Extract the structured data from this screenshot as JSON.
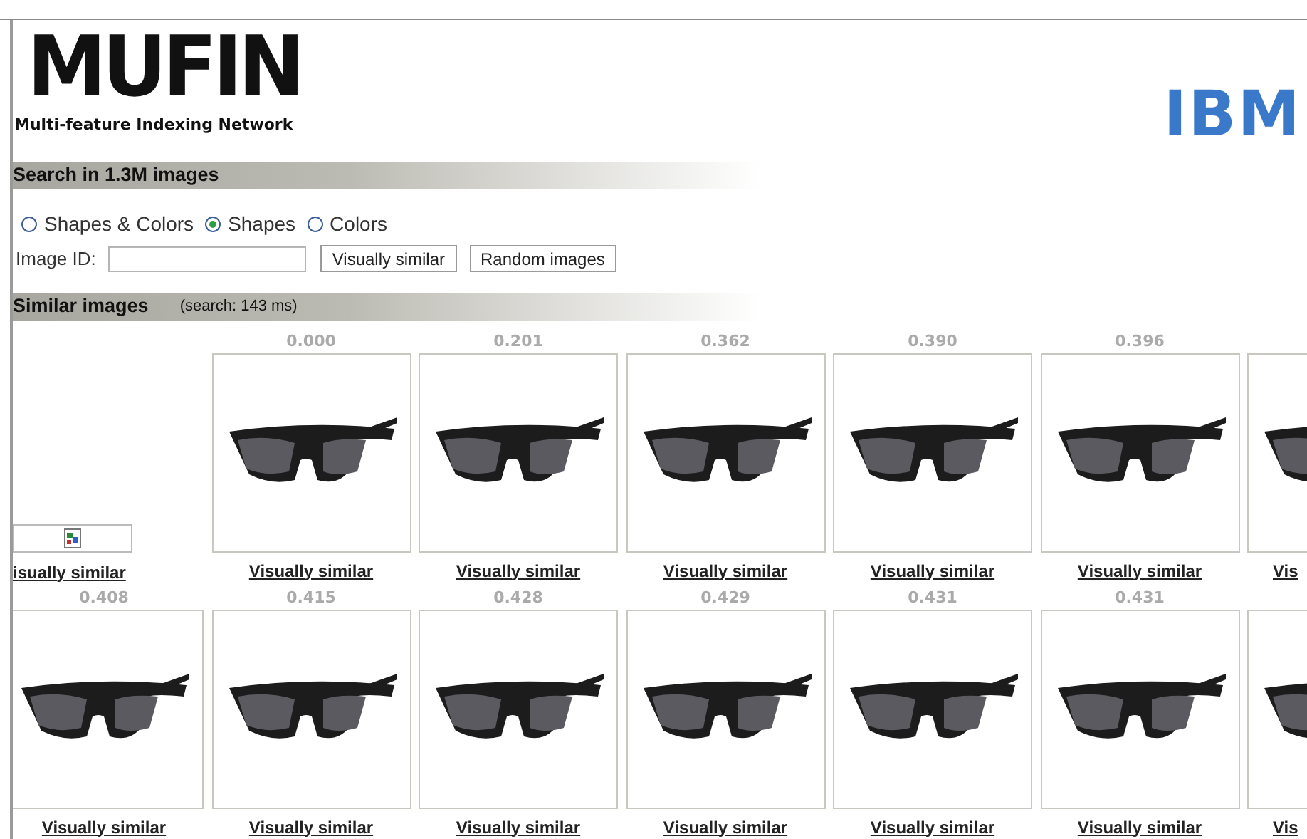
{
  "logo": {
    "title": "MUFIN",
    "subtitle": "Multi-feature Indexing Network"
  },
  "partner_logo": "IBM",
  "search": {
    "heading": "Search in 1.3M images",
    "modes": [
      {
        "label": "Shapes & Colors",
        "selected": false
      },
      {
        "label": "Shapes",
        "selected": true
      },
      {
        "label": "Colors",
        "selected": false
      }
    ],
    "image_id_label": "Image ID:",
    "buttons": [
      "Visually similar",
      "Random images"
    ]
  },
  "results": {
    "heading": "Similar images",
    "timing": "(search: 143 ms)",
    "rows": [
      [
        {
          "kind": "broken",
          "link": "isually similar"
        },
        {
          "kind": "photo",
          "score": "0.000",
          "link": "Visually similar"
        },
        {
          "kind": "photo",
          "score": "0.201",
          "link": "Visually similar"
        },
        {
          "kind": "photo",
          "score": "0.362",
          "link": "Visually similar"
        },
        {
          "kind": "photo",
          "score": "0.390",
          "link": "Visually similar"
        },
        {
          "kind": "photo",
          "score": "0.396",
          "link": "Visually similar"
        },
        {
          "kind": "partial",
          "link": "Vis"
        }
      ],
      [
        {
          "kind": "photo",
          "score": "0.408",
          "link": "Visually similar"
        },
        {
          "kind": "photo",
          "score": "0.415",
          "link": "Visually similar"
        },
        {
          "kind": "photo",
          "score": "0.428",
          "link": "Visually similar"
        },
        {
          "kind": "photo",
          "score": "0.429",
          "link": "Visually similar"
        },
        {
          "kind": "photo",
          "score": "0.431",
          "link": "Visually similar"
        },
        {
          "kind": "photo",
          "score": "0.431",
          "link": "Visually similar"
        },
        {
          "kind": "partial",
          "link": "Vis"
        }
      ]
    ]
  }
}
